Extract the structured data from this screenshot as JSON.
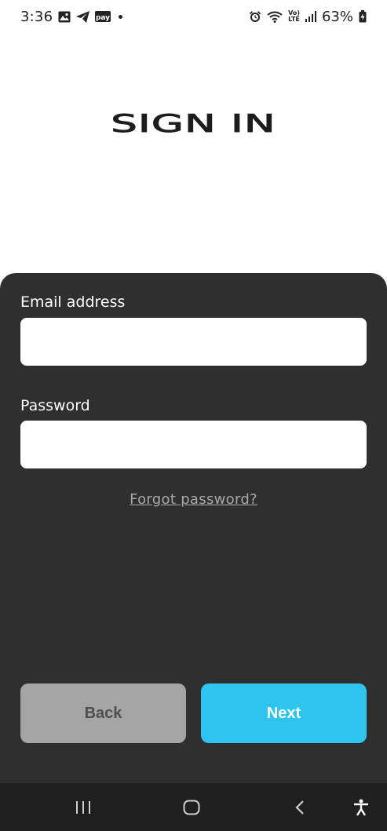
{
  "status_bar": {
    "time": "3:36",
    "battery_percent": "63%",
    "network_label_top": "Vo)",
    "network_label_bottom": "LTE",
    "left_icons": [
      "image-icon",
      "telegram-icon",
      "paytm-icon",
      "notification-dot"
    ],
    "right_icons": [
      "alarm-icon",
      "wifi-icon",
      "volte-icon",
      "signal-icon",
      "battery-icon"
    ]
  },
  "header": {
    "title": "SIGN IN"
  },
  "form": {
    "email_label": "Email address",
    "email_value": "",
    "email_placeholder": "",
    "password_label": "Password",
    "password_value": "",
    "password_placeholder": "",
    "forgot_password": "Forgot password?"
  },
  "actions": {
    "back_label": "Back",
    "next_label": "Next"
  },
  "nav_bar": {
    "icons": [
      "recent-apps-icon",
      "home-icon",
      "back-icon",
      "accessibility-icon"
    ]
  },
  "colors": {
    "panel_bg": "#2f2f2f",
    "next_button": "#2ec4ef",
    "back_button": "#a5a5a5",
    "nav_bar_bg": "#1f1f1f",
    "link": "#a9a9a9"
  }
}
